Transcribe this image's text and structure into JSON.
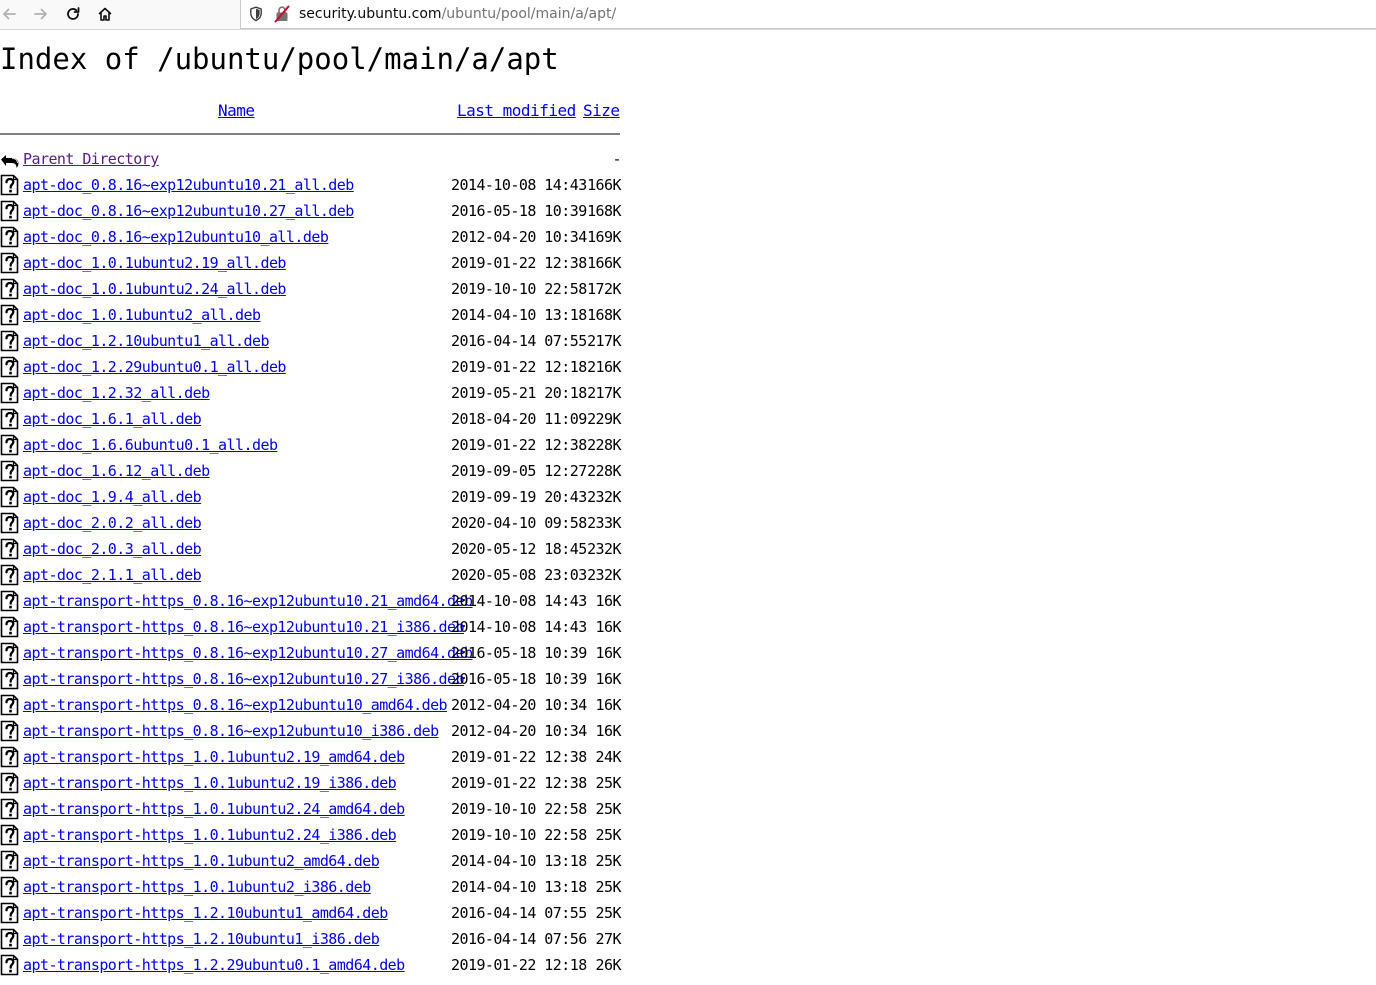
{
  "browser": {
    "url_scheme_hidden": "",
    "url_host": "security.ubuntu.com",
    "url_path": "/ubuntu/pool/main/a/apt/"
  },
  "page": {
    "title": "Index of /ubuntu/pool/main/a/apt",
    "columns": {
      "name": "Name",
      "last_modified": "Last modified",
      "size": "Size"
    },
    "parent": {
      "label": "Parent Directory",
      "size": "-"
    },
    "files": [
      {
        "name": "apt-doc_0.8.16~exp12ubuntu10.21_all.deb",
        "modified": "2014-10-08 14:43",
        "size": "166K"
      },
      {
        "name": "apt-doc_0.8.16~exp12ubuntu10.27_all.deb",
        "modified": "2016-05-18 10:39",
        "size": "168K"
      },
      {
        "name": "apt-doc_0.8.16~exp12ubuntu10_all.deb",
        "modified": "2012-04-20 10:34",
        "size": "169K"
      },
      {
        "name": "apt-doc_1.0.1ubuntu2.19_all.deb",
        "modified": "2019-01-22 12:38",
        "size": "166K"
      },
      {
        "name": "apt-doc_1.0.1ubuntu2.24_all.deb",
        "modified": "2019-10-10 22:58",
        "size": "172K"
      },
      {
        "name": "apt-doc_1.0.1ubuntu2_all.deb",
        "modified": "2014-04-10 13:18",
        "size": "168K"
      },
      {
        "name": "apt-doc_1.2.10ubuntu1_all.deb",
        "modified": "2016-04-14 07:55",
        "size": "217K"
      },
      {
        "name": "apt-doc_1.2.29ubuntu0.1_all.deb",
        "modified": "2019-01-22 12:18",
        "size": "216K"
      },
      {
        "name": "apt-doc_1.2.32_all.deb",
        "modified": "2019-05-21 20:18",
        "size": "217K"
      },
      {
        "name": "apt-doc_1.6.1_all.deb",
        "modified": "2018-04-20 11:09",
        "size": "229K"
      },
      {
        "name": "apt-doc_1.6.6ubuntu0.1_all.deb",
        "modified": "2019-01-22 12:38",
        "size": "228K"
      },
      {
        "name": "apt-doc_1.6.12_all.deb",
        "modified": "2019-09-05 12:27",
        "size": "228K"
      },
      {
        "name": "apt-doc_1.9.4_all.deb",
        "modified": "2019-09-19 20:43",
        "size": "232K"
      },
      {
        "name": "apt-doc_2.0.2_all.deb",
        "modified": "2020-04-10 09:58",
        "size": "233K"
      },
      {
        "name": "apt-doc_2.0.3_all.deb",
        "modified": "2020-05-12 18:45",
        "size": "232K"
      },
      {
        "name": "apt-doc_2.1.1_all.deb",
        "modified": "2020-05-08 23:03",
        "size": "232K"
      },
      {
        "name": "apt-transport-https_0.8.16~exp12ubuntu10.21_amd64.deb",
        "modified": "2014-10-08 14:43",
        "size": "16K"
      },
      {
        "name": "apt-transport-https_0.8.16~exp12ubuntu10.21_i386.deb",
        "modified": "2014-10-08 14:43",
        "size": "16K"
      },
      {
        "name": "apt-transport-https_0.8.16~exp12ubuntu10.27_amd64.deb",
        "modified": "2016-05-18 10:39",
        "size": "16K"
      },
      {
        "name": "apt-transport-https_0.8.16~exp12ubuntu10.27_i386.deb",
        "modified": "2016-05-18 10:39",
        "size": "16K"
      },
      {
        "name": "apt-transport-https_0.8.16~exp12ubuntu10_amd64.deb",
        "modified": "2012-04-20 10:34",
        "size": "16K"
      },
      {
        "name": "apt-transport-https_0.8.16~exp12ubuntu10_i386.deb",
        "modified": "2012-04-20 10:34",
        "size": "16K"
      },
      {
        "name": "apt-transport-https_1.0.1ubuntu2.19_amd64.deb",
        "modified": "2019-01-22 12:38",
        "size": "24K"
      },
      {
        "name": "apt-transport-https_1.0.1ubuntu2.19_i386.deb",
        "modified": "2019-01-22 12:38",
        "size": "25K"
      },
      {
        "name": "apt-transport-https_1.0.1ubuntu2.24_amd64.deb",
        "modified": "2019-10-10 22:58",
        "size": "25K"
      },
      {
        "name": "apt-transport-https_1.0.1ubuntu2.24_i386.deb",
        "modified": "2019-10-10 22:58",
        "size": "25K"
      },
      {
        "name": "apt-transport-https_1.0.1ubuntu2_amd64.deb",
        "modified": "2014-04-10 13:18",
        "size": "25K"
      },
      {
        "name": "apt-transport-https_1.0.1ubuntu2_i386.deb",
        "modified": "2014-04-10 13:18",
        "size": "25K"
      },
      {
        "name": "apt-transport-https_1.2.10ubuntu1_amd64.deb",
        "modified": "2016-04-14 07:55",
        "size": "25K"
      },
      {
        "name": "apt-transport-https_1.2.10ubuntu1_i386.deb",
        "modified": "2016-04-14 07:56",
        "size": "27K"
      },
      {
        "name": "apt-transport-https_1.2.29ubuntu0.1_amd64.deb",
        "modified": "2019-01-22 12:18",
        "size": "26K"
      }
    ]
  }
}
